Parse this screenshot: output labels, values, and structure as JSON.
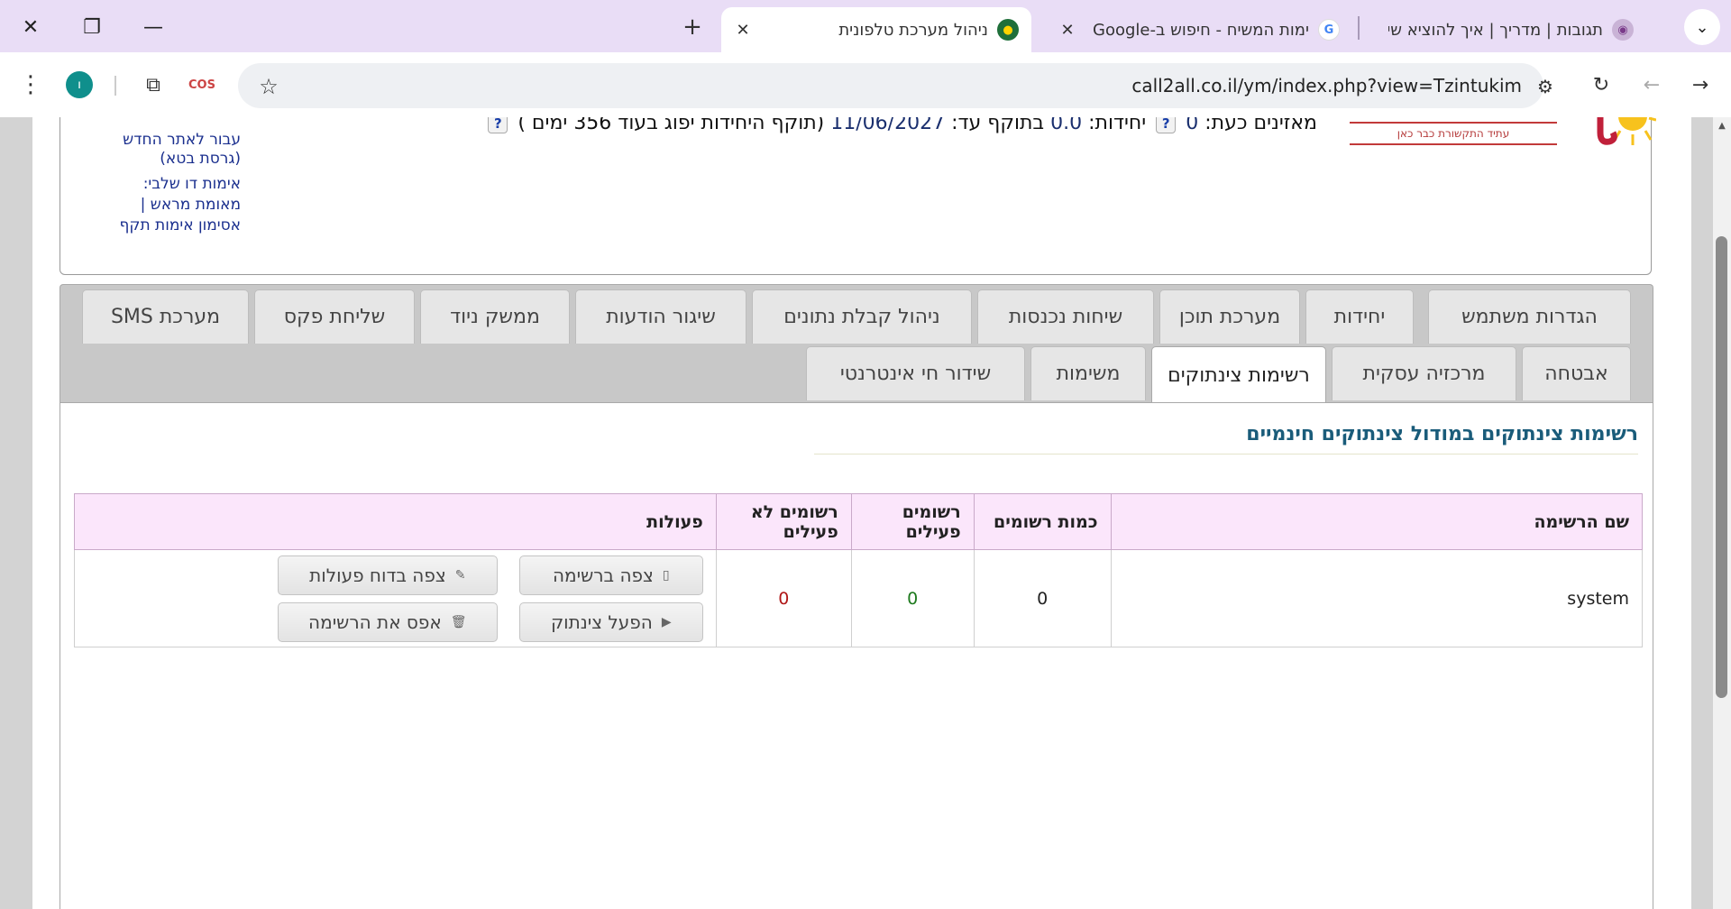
{
  "browser": {
    "tabs": [
      {
        "title": "ניהול מערכת טלפונית",
        "active": true
      },
      {
        "title": "ימות המשיח - חיפוש ב-Google",
        "active": false
      },
      {
        "title": "תגובות | מדריך | איך להוציא שיחה",
        "active": false
      }
    ],
    "url": "call2all.co.il/ym/index.php?view=Tzintukim",
    "icons": [
      "close-icon",
      "restore-icon",
      "minimize-icon",
      "new-tab-icon",
      "tab-search-icon",
      "menu-icon",
      "profile-icon",
      "extensions-icon",
      "star-icon",
      "site-info-icon",
      "reload-icon",
      "back-icon",
      "forward-icon"
    ]
  },
  "header": {
    "logo_tagline": "עתיד התקשורת כבר כאן",
    "status": {
      "listeners_label": "מאזינים כעת:",
      "listeners_value": "0",
      "units_label": "יחידות:",
      "units_value": "0.0",
      "valid_until_label": "בתוקף עד:",
      "valid_until_value": "11/06/2027",
      "expiry_note": "(תוקף היחידות יפוג בעוד 356 ימים )",
      "help_mark": "?"
    },
    "side_links": {
      "new_site": "עבור לאתר החדש",
      "beta": "(גרסת בטא)",
      "two_step_label": "אימות דו שלבי:",
      "pre_authenticated": "מאומת מראש |",
      "auth_token": "אסימון אימות תקף"
    }
  },
  "nav": {
    "row1": [
      "הגדרות משתמש",
      "יחידות",
      "מערכת תוכן",
      "שיחות נכנסות",
      "ניהול קבלת נתונים",
      "שיגור הודעות",
      "ממשק ניוד",
      "שליחת פקס",
      "מערכת SMS"
    ],
    "row2": [
      "אבטחה",
      "מרכזיה עסקית",
      "רשימות צינתוקים",
      "משימות",
      "שידור חי אינטרנטי"
    ],
    "active": "רשימות צינתוקים"
  },
  "panel": {
    "title": "רשימות צינתוקים במודול צינתוקים חינמיים",
    "table": {
      "headers": [
        "שם הרשימה",
        "כמות רשומים",
        "רשומים פעילים",
        "רשומים לא פעילים",
        "פעולות"
      ],
      "rows": [
        {
          "name": "system",
          "total": "0",
          "active": "0",
          "inactive": "0",
          "actions": {
            "view_list": "צפה ברשימה",
            "view_report": "צפה בדוח פעולות",
            "activate": "הפעל צינתוק",
            "reset_list": "אפס את הרשימה"
          }
        }
      ]
    }
  },
  "colors": {
    "tabstrip_bg": "#e9ddf6",
    "panel_title": "#1a5c7a",
    "table_header_bg": "#fbe6fb",
    "active_count": "#1e7a1e",
    "inactive_count": "#b01818"
  }
}
